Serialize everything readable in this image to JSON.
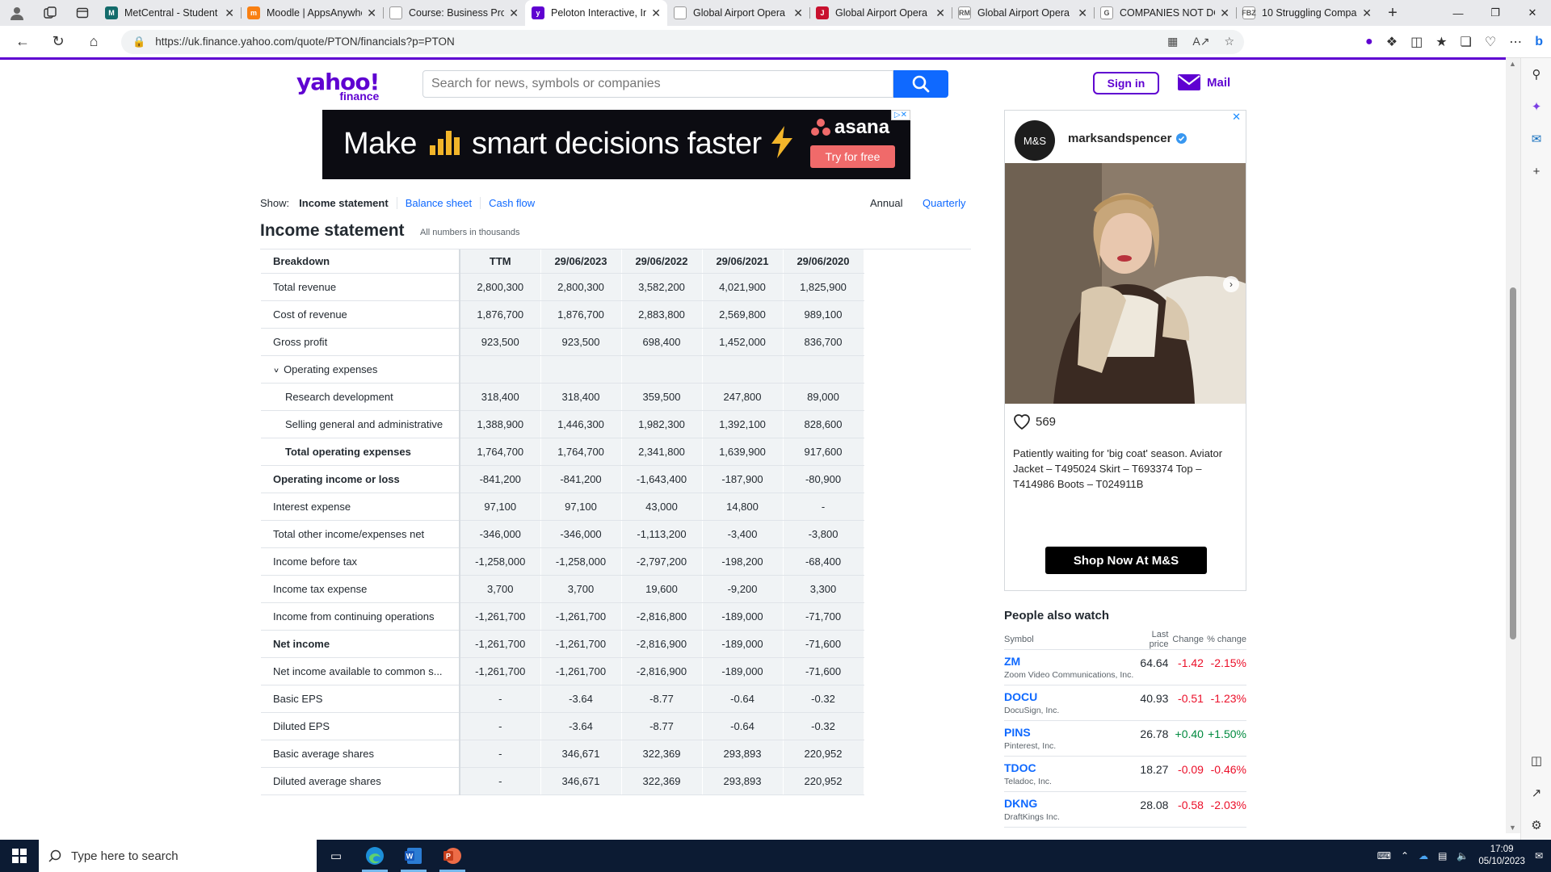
{
  "browser": {
    "tabs": [
      {
        "title": "MetCentral - Student",
        "color": "#136b6b",
        "glyph": "M"
      },
      {
        "title": "Moodle | AppsAnywhere",
        "color": "#f98012",
        "glyph": "m"
      },
      {
        "title": "Course: Business Pro",
        "color": "#ffffff",
        "glyph": ""
      },
      {
        "title": "Peloton Interactive, In",
        "color": "#5f01d1",
        "glyph": "y",
        "active": true
      },
      {
        "title": "Global Airport Opera",
        "color": "#ffffff",
        "glyph": ""
      },
      {
        "title": "Global Airport Opera",
        "color": "#c8102e",
        "glyph": "J"
      },
      {
        "title": "Global Airport Opera",
        "color": "#ffffff",
        "glyph": "RM"
      },
      {
        "title": "COMPANIES NOT DO",
        "color": "#ffffff",
        "glyph": "G"
      },
      {
        "title": "10 Struggling Compa",
        "color": "#ffffff",
        "glyph": "FBZ"
      }
    ],
    "url": "https://uk.finance.yahoo.com/quote/PTON/financials?p=PTON"
  },
  "header": {
    "logo_main": "yahoo!",
    "logo_sub": "finance",
    "search_placeholder": "Search for news, symbols or companies",
    "signin_label": "Sign in",
    "mail_label": "Mail"
  },
  "ad": {
    "headline_left": "Make",
    "headline_right": "smart decisions faster",
    "brand": "asana",
    "cta": "Try for free"
  },
  "financials": {
    "show_label": "Show:",
    "tabs": [
      "Income statement",
      "Balance sheet",
      "Cash flow"
    ],
    "period_annual": "Annual",
    "period_quarterly": "Quarterly",
    "title": "Income statement",
    "note": "All numbers in thousands",
    "columns": [
      "Breakdown",
      "TTM",
      "29/06/2023",
      "29/06/2022",
      "29/06/2021",
      "29/06/2020"
    ],
    "rows": [
      {
        "label": "Total revenue",
        "values": [
          "2,800,300",
          "2,800,300",
          "3,582,200",
          "4,021,900",
          "1,825,900"
        ]
      },
      {
        "label": "Cost of revenue",
        "values": [
          "1,876,700",
          "1,876,700",
          "2,883,800",
          "2,569,800",
          "989,100"
        ]
      },
      {
        "label": "Gross profit",
        "values": [
          "923,500",
          "923,500",
          "698,400",
          "1,452,000",
          "836,700"
        ]
      },
      {
        "label": "Operating expenses",
        "values": [
          "",
          "",
          "",
          "",
          ""
        ],
        "expand": true
      },
      {
        "label": "Research development",
        "values": [
          "318,400",
          "318,400",
          "359,500",
          "247,800",
          "89,000"
        ],
        "indent": true
      },
      {
        "label": "Selling general and administrative",
        "values": [
          "1,388,900",
          "1,446,300",
          "1,982,300",
          "1,392,100",
          "828,600"
        ],
        "indent": true
      },
      {
        "label": "Total operating expenses",
        "values": [
          "1,764,700",
          "1,764,700",
          "2,341,800",
          "1,639,900",
          "917,600"
        ],
        "indent": true,
        "bold": true
      },
      {
        "label": "Operating income or loss",
        "values": [
          "-841,200",
          "-841,200",
          "-1,643,400",
          "-187,900",
          "-80,900"
        ],
        "bold": true
      },
      {
        "label": "Interest expense",
        "values": [
          "97,100",
          "97,100",
          "43,000",
          "14,800",
          "-"
        ]
      },
      {
        "label": "Total other income/expenses net",
        "values": [
          "-346,000",
          "-346,000",
          "-1,113,200",
          "-3,400",
          "-3,800"
        ]
      },
      {
        "label": "Income before tax",
        "values": [
          "-1,258,000",
          "-1,258,000",
          "-2,797,200",
          "-198,200",
          "-68,400"
        ]
      },
      {
        "label": "Income tax expense",
        "values": [
          "3,700",
          "3,700",
          "19,600",
          "-9,200",
          "3,300"
        ]
      },
      {
        "label": "Income from continuing operations",
        "values": [
          "-1,261,700",
          "-1,261,700",
          "-2,816,800",
          "-189,000",
          "-71,700"
        ]
      },
      {
        "label": "Net income",
        "values": [
          "-1,261,700",
          "-1,261,700",
          "-2,816,900",
          "-189,000",
          "-71,600"
        ],
        "bold": true
      },
      {
        "label": "Net income available to common s...",
        "values": [
          "-1,261,700",
          "-1,261,700",
          "-2,816,900",
          "-189,000",
          "-71,600"
        ]
      },
      {
        "label": "Basic EPS",
        "values": [
          "-",
          "-3.64",
          "-8.77",
          "-0.64",
          "-0.32"
        ]
      },
      {
        "label": "Diluted EPS",
        "values": [
          "-",
          "-3.64",
          "-8.77",
          "-0.64",
          "-0.32"
        ]
      },
      {
        "label": "Basic average shares",
        "values": [
          "-",
          "346,671",
          "322,369",
          "293,893",
          "220,952"
        ]
      },
      {
        "label": "Diluted average shares",
        "values": [
          "-",
          "346,671",
          "322,369",
          "293,893",
          "220,952"
        ]
      }
    ]
  },
  "sidebar_ad": {
    "avatar": "M&S",
    "handle": "marksandspencer",
    "likes": "569",
    "caption": "Patiently waiting for 'big coat' season. Aviator Jacket – T495024 Skirt – T693374 Top – T414986 Boots – T024911B",
    "cta": "Shop Now At M&S"
  },
  "people_also_watch": {
    "title": "People also watch",
    "headers": [
      "Symbol",
      "Last price",
      "Change",
      "% change"
    ],
    "rows": [
      {
        "symbol": "ZM",
        "name": "Zoom Video Communications, Inc.",
        "price": "64.64",
        "change": "-1.42",
        "pct": "-2.15%",
        "dir": "neg"
      },
      {
        "symbol": "DOCU",
        "name": "DocuSign, Inc.",
        "price": "40.93",
        "change": "-0.51",
        "pct": "-1.23%",
        "dir": "neg"
      },
      {
        "symbol": "PINS",
        "name": "Pinterest, Inc.",
        "price": "26.78",
        "change": "+0.40",
        "pct": "+1.50%",
        "dir": "pos"
      },
      {
        "symbol": "TDOC",
        "name": "Teladoc, Inc.",
        "price": "18.27",
        "change": "-0.09",
        "pct": "-0.46%",
        "dir": "neg"
      },
      {
        "symbol": "DKNG",
        "name": "DraftKings Inc.",
        "price": "28.08",
        "change": "-0.58",
        "pct": "-2.03%",
        "dir": "neg"
      }
    ]
  },
  "taskbar": {
    "search_placeholder": "Type here to search",
    "time": "17:09",
    "date": "05/10/2023"
  }
}
